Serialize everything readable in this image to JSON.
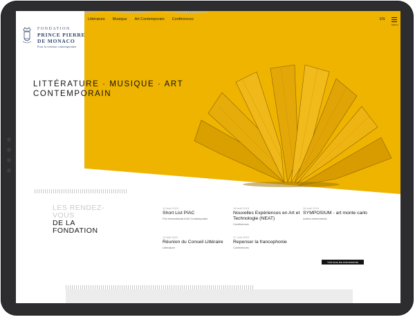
{
  "brand": {
    "line1": "FONDATION",
    "line2": "PRINCE PIERRE",
    "line3": "DE MONACO",
    "line4": "Pour la création contemporaine"
  },
  "nav": {
    "items": [
      "Littérature",
      "Musique",
      "Art Contemporain",
      "Conférences"
    ],
    "lang": "EN",
    "menu_label": "MENU"
  },
  "hero": {
    "headline_line1": "LITTÉRATURE · MUSIQUE · ART",
    "headline_line2": "CONTEMPORAIN",
    "accent_color": "#efb400"
  },
  "events_section": {
    "title_light_1": "LES RENDEZ-",
    "title_light_2": "VOUS",
    "title_dark_1": "DE LA",
    "title_dark_2": "FONDATION",
    "events": [
      {
        "date": "12 Avril 2019",
        "title": "Short List PIAC",
        "category": "Prix International d'Art Contemporain"
      },
      {
        "date": "18 Avril 2019",
        "title": "Nouvelles Expériences en Art et Technologie (NEAT)",
        "category": "Conférences"
      },
      {
        "date": "26 Avril 2019",
        "title": "SYMPOSIUM - art monte carlo",
        "category": "Autres événements"
      },
      {
        "date": "14 Mai 2019",
        "title": "Réunion du Conseil Littéraire",
        "category": "Littérature"
      },
      {
        "date": "27 Juin 2019",
        "title": "Repenser la francophonie",
        "category": "Conférences"
      }
    ],
    "all_events_label": "Voir tous les événements"
  }
}
